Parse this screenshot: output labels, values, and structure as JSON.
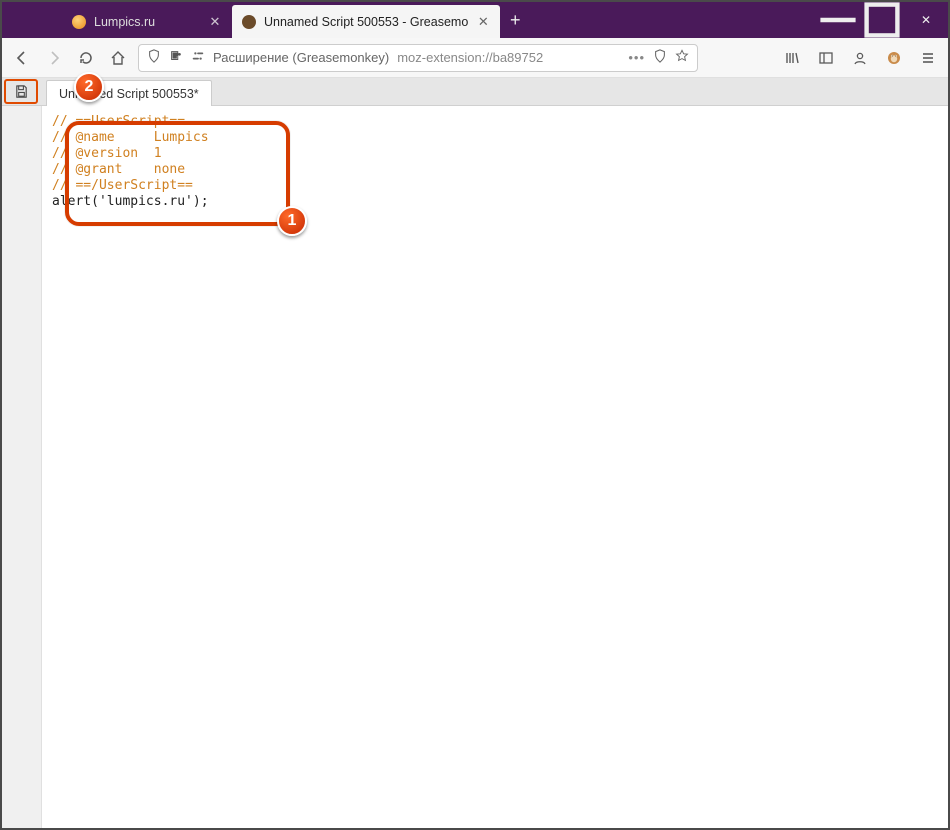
{
  "tabs": {
    "inactive": {
      "title": "Lumpics.ru"
    },
    "active": {
      "title": "Unnamed Script 500553 - Greasemo"
    }
  },
  "urlbar": {
    "extension_label": "Расширение (Greasemonkey)",
    "url": "moz-extension://ba89752",
    "ellipsis": "•••"
  },
  "editor": {
    "tab_label": "Unnamed Script 500553*",
    "code": {
      "l1": "// ==UserScript==",
      "l2": "// @name     Lumpics",
      "l3": "// @version  1",
      "l4": "// @grant    none",
      "l5": "// ==/UserScript==",
      "l6": "alert('lumpics.ru');"
    }
  },
  "callouts": {
    "one": "1",
    "two": "2"
  }
}
